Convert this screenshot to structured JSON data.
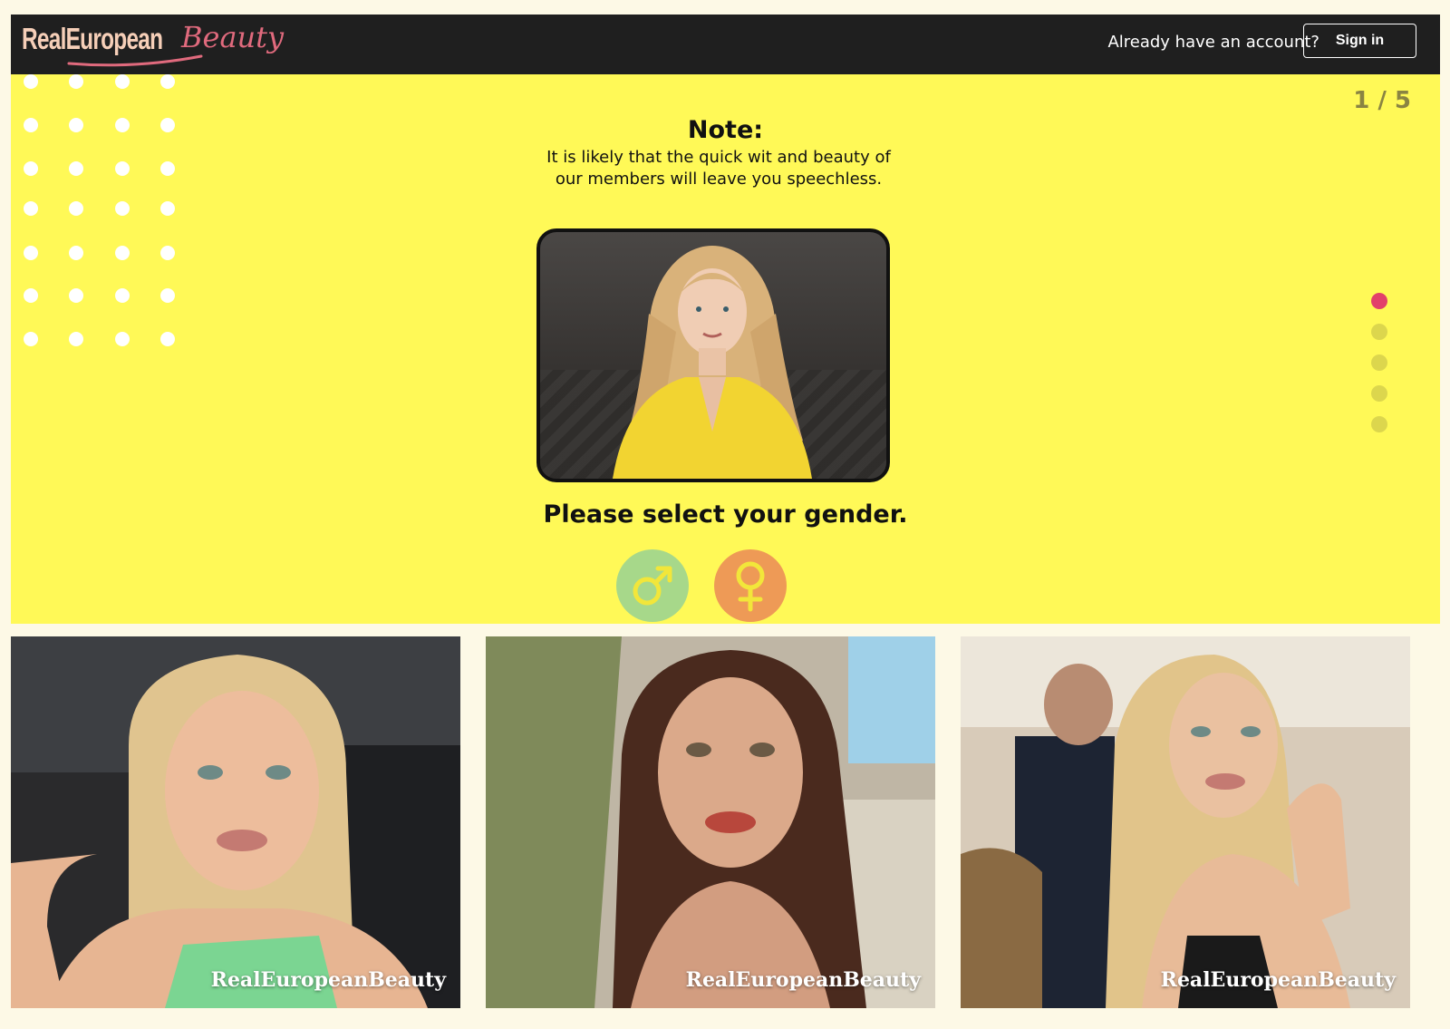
{
  "header": {
    "logo_part1": "RealEuropean",
    "logo_part2": "Beauty",
    "already_text": "Already have an account?",
    "signin_label": "Sign in"
  },
  "quiz": {
    "counter": "1 / 5",
    "note_title": "Note:",
    "note_text": "It is likely that the quick wit and beauty of our members will leave you speechless.",
    "question": "Please select your gender.",
    "options": [
      {
        "icon": "male-symbol-icon",
        "color": "#a7d88a"
      },
      {
        "icon": "female-symbol-icon",
        "color": "#ee9a56"
      }
    ],
    "steps": [
      {
        "active": true
      },
      {
        "active": false
      },
      {
        "active": false
      },
      {
        "active": false
      },
      {
        "active": false
      }
    ]
  },
  "gallery": [
    {
      "watermark": "RealEuropeanBeauty"
    },
    {
      "watermark": "RealEuropeanBeauty"
    },
    {
      "watermark": "RealEuropeanBeauty"
    }
  ],
  "colors": {
    "page_background": "#fdf9e6",
    "quiz_background": "#fff957",
    "header_background": "#1f1f1f",
    "active_step": "#e2416a",
    "inactive_step": "#dcd64d"
  }
}
